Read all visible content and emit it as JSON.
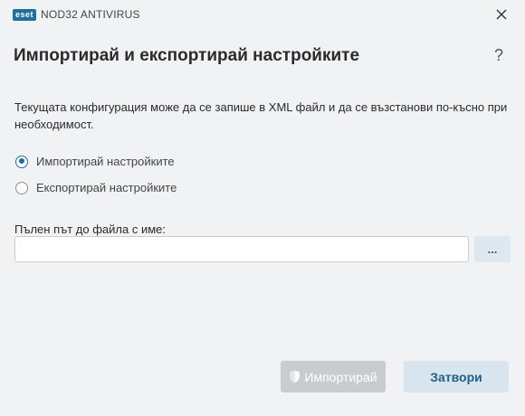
{
  "titlebar": {
    "logo_text": "eset",
    "product_name": "NOD32 ANTIVIRUS"
  },
  "dialog": {
    "title": "Импортирай и експортирай настройките",
    "help_label": "?",
    "description": "Текущата конфигурация може да се запише в XML файл и да се възстанови по-късно при необходимост."
  },
  "options": [
    {
      "label": "Импортирай настройките",
      "selected": true
    },
    {
      "label": "Експортирай настройките",
      "selected": false
    }
  ],
  "path": {
    "label": "Пълен път до файла с име:",
    "value": "",
    "browse_label": "..."
  },
  "buttons": {
    "import_label": "Импортирай",
    "close_label": "Затвори"
  },
  "colors": {
    "accent": "#1f6f9f",
    "background": "#f1f2f4",
    "disabled_button": "#c8cbcf",
    "secondary_button": "#d9e5ee"
  }
}
